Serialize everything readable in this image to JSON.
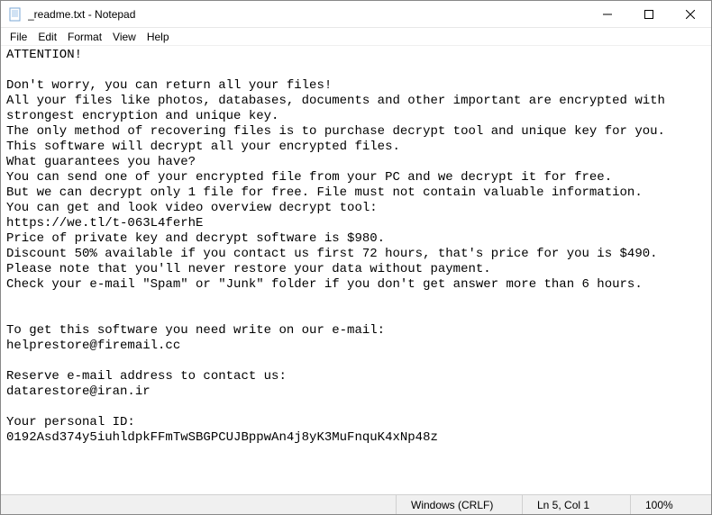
{
  "window": {
    "title": "_readme.txt - Notepad"
  },
  "menu": {
    "file": "File",
    "edit": "Edit",
    "format": "Format",
    "view": "View",
    "help": "Help"
  },
  "content": {
    "text": "ATTENTION!\n\nDon't worry, you can return all your files!\nAll your files like photos, databases, documents and other important are encrypted with strongest encryption and unique key.\nThe only method of recovering files is to purchase decrypt tool and unique key for you.\nThis software will decrypt all your encrypted files.\nWhat guarantees you have?\nYou can send one of your encrypted file from your PC and we decrypt it for free.\nBut we can decrypt only 1 file for free. File must not contain valuable information.\nYou can get and look video overview decrypt tool:\nhttps://we.tl/t-063L4ferhE\nPrice of private key and decrypt software is $980.\nDiscount 50% available if you contact us first 72 hours, that's price for you is $490.\nPlease note that you'll never restore your data without payment.\nCheck your e-mail \"Spam\" or \"Junk\" folder if you don't get answer more than 6 hours.\n\n\nTo get this software you need write on our e-mail:\nhelprestore@firemail.cc\n\nReserve e-mail address to contact us:\ndatarestore@iran.ir\n\nYour personal ID:\n0192Asd374y5iuhldpkFFmTwSBGPCUJBppwAn4j8yK3MuFnquK4xNp48z"
  },
  "status": {
    "encoding": "Windows (CRLF)",
    "cursor": "Ln 5, Col 1",
    "zoom": "100%"
  }
}
